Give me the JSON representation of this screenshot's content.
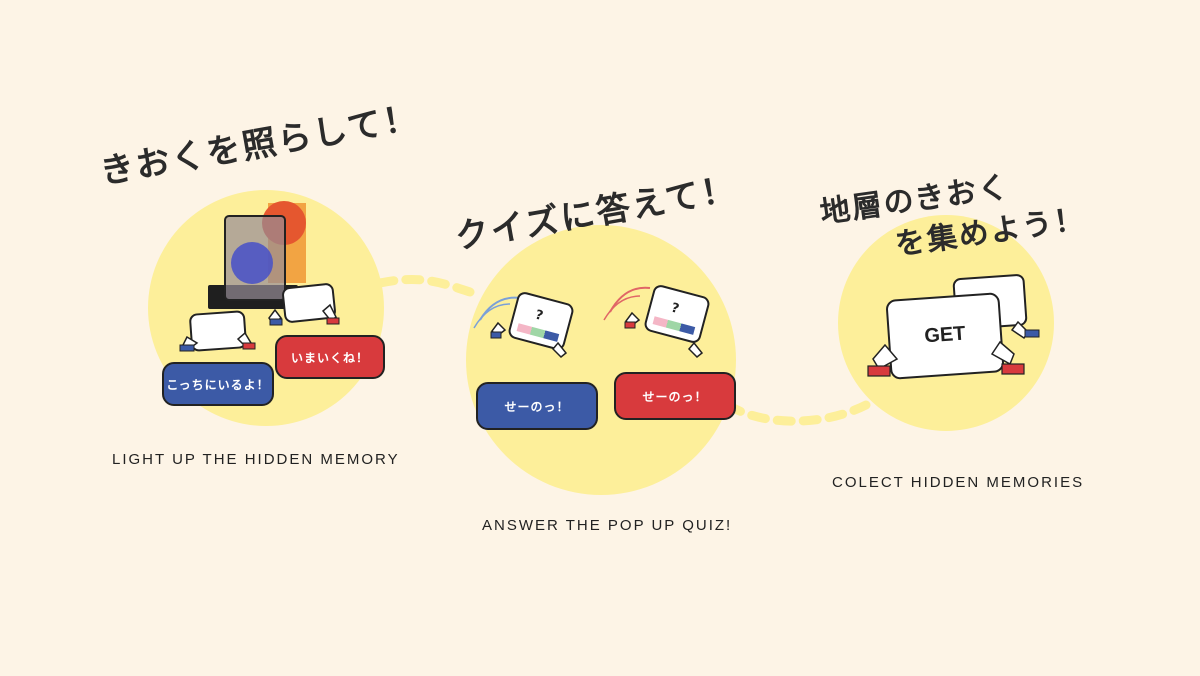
{
  "sections": [
    {
      "heading": "きおくを照らして！",
      "caption": "LIGHT UP THE HIDDEN MEMORY",
      "bubbles": [
        "こっちにいるよ！",
        "いまいくね！"
      ]
    },
    {
      "heading": "クイズに答えて！",
      "caption": "ANSWER THE POP UP QUIZ!",
      "bubbles": [
        "せーのっ！",
        "せーのっ！"
      ],
      "quiz_mark": "?"
    },
    {
      "heading_line1": "地層のきおく",
      "heading_line2": "を集めよう！",
      "caption": "COLECT HIDDEN MEMORIES",
      "card_label": "GET"
    }
  ],
  "colors": {
    "background": "#fdf4e6",
    "blob": "#fdef9a",
    "blue": "#3c5aa6",
    "red": "#d83a3d"
  }
}
